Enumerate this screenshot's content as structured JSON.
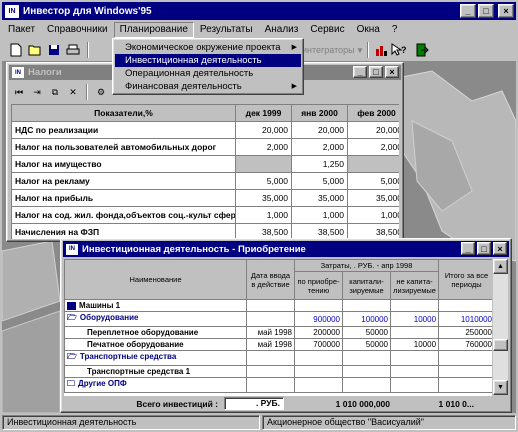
{
  "app": {
    "title": "Инвестор для Windows'95",
    "icon_text": "IN"
  },
  "menu": [
    "Пакет",
    "Справочники",
    "Планирование",
    "Результаты",
    "Анализ",
    "Сервис",
    "Окна",
    "?"
  ],
  "toolbar": {
    "combo_text": "интеграторы"
  },
  "planning_menu": {
    "items": [
      {
        "label": "Экономическое окружение проекта",
        "submenu": true
      },
      {
        "label": "Инвестиционная деятельность",
        "submenu": false
      },
      {
        "label": "Операционная деятельность",
        "submenu": false
      },
      {
        "label": "Финансовая деятельность",
        "submenu": true
      }
    ]
  },
  "taxes": {
    "title": "Налоги",
    "header": [
      "Показатели,%",
      "дек 1999",
      "янв 2000",
      "фев 2000"
    ],
    "rows": [
      [
        "НДС по реализации",
        "20,000",
        "20,000",
        "20,000"
      ],
      [
        "Налог на пользователей автомобильных дорог",
        "2,000",
        "2,000",
        "2,000"
      ],
      [
        "Налог на имущество",
        "",
        "1,250",
        ""
      ],
      [
        "Налог на рекламу",
        "5,000",
        "5,000",
        "5,000"
      ],
      [
        "Налог на прибыль",
        "35,000",
        "35,000",
        "35,000"
      ],
      [
        "Налог на сод. жил. фонда,объектов соц.-культ сферы",
        "1,000",
        "1,000",
        "1,000"
      ],
      [
        "Начисления на ФЗП",
        "38,500",
        "38,500",
        "38,500"
      ]
    ]
  },
  "invest": {
    "title": "Инвестиционная деятельность - Приобретение",
    "header": {
      "name": "Наименование",
      "date": "Дата ввода в действие",
      "costs_group": "Затраты, . РУБ. - апр 1998",
      "by_purchase": "по приобре- тению",
      "capitalized": "капитали- зируемые",
      "not_capitalized": "не капита- лизируемые",
      "total": "Итого за все периоды"
    },
    "rows": [
      {
        "name": "Машины 1",
        "date": "",
        "a": "",
        "b": "",
        "c": "",
        "total": ""
      },
      {
        "name": "Оборудование",
        "date": "",
        "a": "900000",
        "b": "100000",
        "c": "10000",
        "total": "1010000"
      },
      {
        "name": "Переплетное оборудование",
        "date": "май 1998",
        "a": "200000",
        "b": "50000",
        "c": "",
        "total": "250000"
      },
      {
        "name": "Печатное оборудование",
        "date": "май 1998",
        "a": "700000",
        "b": "50000",
        "c": "10000",
        "total": "760000"
      },
      {
        "name": "Транспортные средства",
        "date": "",
        "a": "",
        "b": "",
        "c": "",
        "total": ""
      },
      {
        "name": "Транспортные средства 1",
        "date": "",
        "a": "",
        "b": "",
        "c": "",
        "total": ""
      },
      {
        "name": "Другие ОПФ",
        "date": "",
        "a": "",
        "b": "",
        "c": "",
        "total": ""
      }
    ],
    "footer": {
      "label": "Всего инвестиций :",
      "unit": ". РУБ.",
      "value1": "1 010 000,000",
      "value2": "1 010 0..."
    }
  },
  "status": {
    "left": "Инвестиционная деятельность",
    "right": "Акционерное общество \"Васисуалий\""
  },
  "colors": {
    "titlebar": "#000080",
    "desktop": "#808080",
    "face": "#c0c0c0",
    "group_text": "#000080",
    "value_text": "#0000cc"
  }
}
